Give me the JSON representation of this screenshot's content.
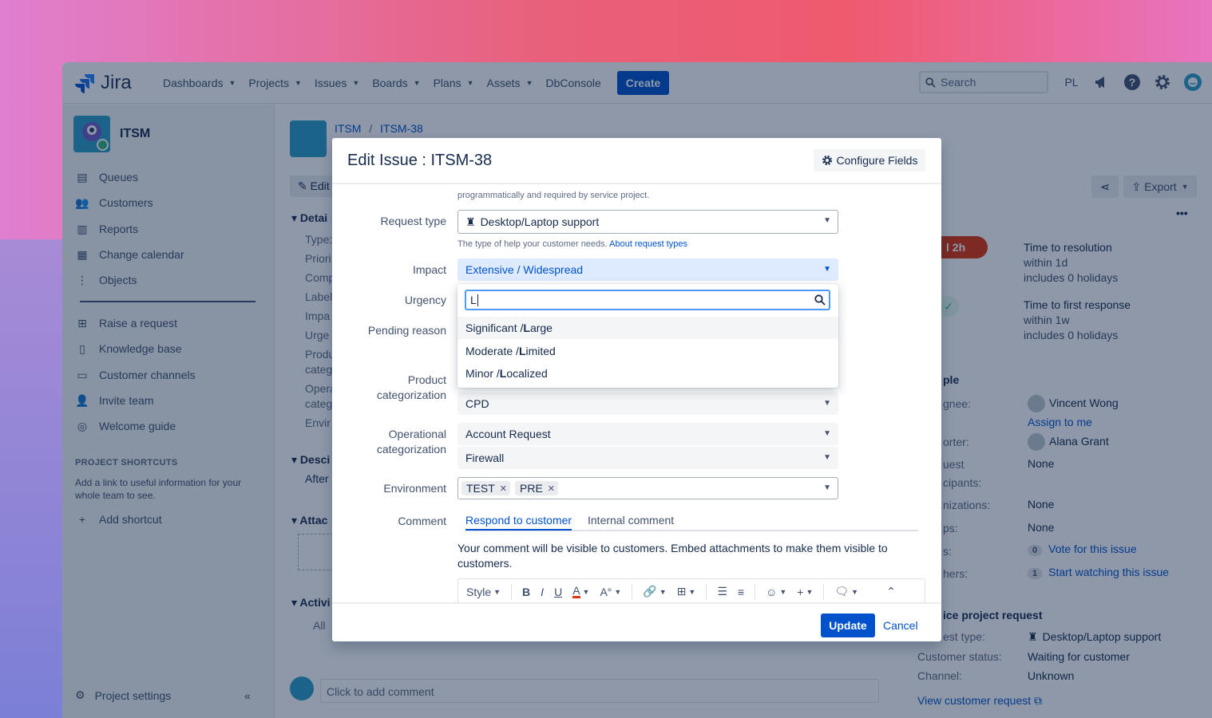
{
  "topnav": {
    "logo": "Jira",
    "items": [
      "Dashboards",
      "Projects",
      "Issues",
      "Boards",
      "Plans",
      "Assets"
    ],
    "dbconsole": "DbConsole",
    "create": "Create",
    "search_placeholder": "Search",
    "user_initials": "PL"
  },
  "sidebar": {
    "project": "ITSM",
    "items": [
      "Queues",
      "Customers",
      "Reports",
      "Change calendar",
      "Objects"
    ],
    "items2": [
      "Raise a request",
      "Knowledge base",
      "Customer channels",
      "Invite team",
      "Welcome guide"
    ],
    "shortcuts_title": "PROJECT SHORTCUTS",
    "shortcuts_desc": "Add a link to useful information for your whole team to see.",
    "add_shortcut": "Add shortcut",
    "settings": "Project settings"
  },
  "main": {
    "crumb_project": "ITSM",
    "crumb_sep": "/",
    "crumb_issue": "ITSM-38",
    "edit": "Edit",
    "details": "Detai",
    "left_labels": [
      "Type:",
      "Priori",
      "Comp",
      "Label",
      "Impa",
      "Urge",
      "Produ",
      "categ",
      "Opera",
      "categ",
      "Envir"
    ],
    "desc_head": "Desci",
    "desc_text": "After",
    "attach_head": "Attac",
    "activity_head": "Activi",
    "activity_all": "All",
    "comment_placeholder": "Click to add comment",
    "export": "Export",
    "timer": "l 2h",
    "sla1": [
      "Time to resolution",
      "within 1d",
      "includes 0 holidays"
    ],
    "sla2": [
      "Time to first response",
      "within 1w",
      "includes 0 holidays"
    ],
    "people_head": "ple",
    "assignee_label": "gnee:",
    "assignee": "Vincent Wong",
    "assign_to_me": "Assign to me",
    "reporter_label": "orter:",
    "reporter": "Alana Grant",
    "req_part_label1": "uest",
    "req_part_label2": "cipants:",
    "req_part": "None",
    "orgs_label": "nizations:",
    "orgs": "None",
    "groups_label": "ps:",
    "groups": "None",
    "votes_label": "s:",
    "votes_count": "0",
    "vote": "Vote for this issue",
    "watchers_label": "hers:",
    "watchers_count": "1",
    "watch": "Start watching this issue",
    "svc_head": "ice project request",
    "req_type_label": "est type:",
    "req_type": "Desktop/Laptop support",
    "cust_status_label": "Customer status:",
    "cust_status": "Waiting for customer",
    "channel_label": "Channel:",
    "channel": "Unknown",
    "view_request": "View customer request"
  },
  "modal": {
    "title": "Edit Issue : ITSM-38",
    "configure": "Configure Fields",
    "top_help": "programmatically and required by service project.",
    "request_type_label": "Request type",
    "request_type": "Desktop/Laptop support",
    "request_type_help": "The type of help your customer needs.",
    "request_type_link": "About request types",
    "impact_label": "Impact",
    "impact": "Extensive / Widespread",
    "urgency_label": "Urgency",
    "pending_label": "Pending reason",
    "product_label": [
      "Product",
      "categorization"
    ],
    "product_value": "CPD",
    "op_label": [
      "Operational",
      "categorization"
    ],
    "op_value1": "Account Request",
    "op_value2": "Firewall",
    "env_label": "Environment",
    "env_tags": [
      "TEST",
      "PRE"
    ],
    "comment_label": "Comment",
    "tab_respond": "Respond to customer",
    "tab_internal": "Internal comment",
    "comment_note": "Your comment will be visible to customers. Embed attachments to make them visible to customers.",
    "toolbar_style": "Style",
    "update": "Update",
    "cancel": "Cancel",
    "dropdown": {
      "query": "L",
      "options": [
        {
          "pre": "Significant / ",
          "match": "L",
          "post": "arge"
        },
        {
          "pre": "Moderate / ",
          "match": "L",
          "post": "imited"
        },
        {
          "pre": "Minor / ",
          "match": "L",
          "post": "ocalized"
        }
      ]
    }
  }
}
